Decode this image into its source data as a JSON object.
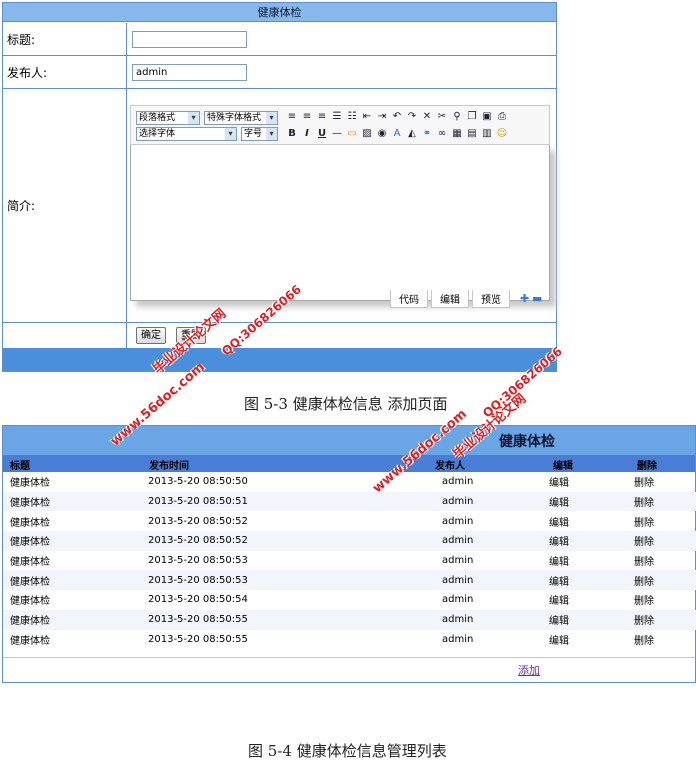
{
  "form": {
    "header": "健康体检",
    "title_label": "标题:",
    "title_value": "",
    "publisher_label": "发布人:",
    "publisher_value": "admin",
    "intro_label": "简介:",
    "editor": {
      "select_paragraph": "段落格式",
      "select_special": "特殊字体格式",
      "select_font": "选择字体",
      "select_size": "字号",
      "tabs": [
        "代码",
        "编辑",
        "预览"
      ]
    },
    "confirm_button": "确定",
    "reset_button": "重置"
  },
  "captions": {
    "fig_5_3": "图 5-3 健康体检信息 添加页面",
    "fig_5_4": "图 5-4 健康体检信息管理列表"
  },
  "list": {
    "title": "健康体检",
    "columns": [
      "标题",
      "发布时间",
      "发布人",
      "编辑",
      "删除"
    ],
    "rows": [
      [
        "健康体检",
        "2013-5-20 08:50:50",
        "admin",
        "编辑",
        "删除"
      ],
      [
        "健康体检",
        "2013-5-20 08:50:51",
        "admin",
        "编辑",
        "删除"
      ],
      [
        "健康体检",
        "2013-5-20 08:50:52",
        "admin",
        "编辑",
        "删除"
      ],
      [
        "健康体检",
        "2013-5-20 08:50:52",
        "admin",
        "编辑",
        "删除"
      ],
      [
        "健康体检",
        "2013-5-20 08:50:53",
        "admin",
        "编辑",
        "删除"
      ],
      [
        "健康体检",
        "2013-5-20 08:50:53",
        "admin",
        "编辑",
        "删除"
      ],
      [
        "健康体检",
        "2013-5-20 08:50:54",
        "admin",
        "编辑",
        "删除"
      ],
      [
        "健康体检",
        "2013-5-20 08:50:55",
        "admin",
        "编辑",
        "删除"
      ],
      [
        "健康体检",
        "2013-5-20 08:50:55",
        "admin",
        "编辑",
        "删除"
      ]
    ],
    "add_link": "添加"
  },
  "watermark": {
    "site": "www.56doc.com",
    "name": "毕业设计论文网",
    "qq": "QQ:306826066"
  },
  "colors": {
    "header_blue": "#86b8ec",
    "footer_blue": "#4a8fdb",
    "watermark_red": "#e02020"
  }
}
